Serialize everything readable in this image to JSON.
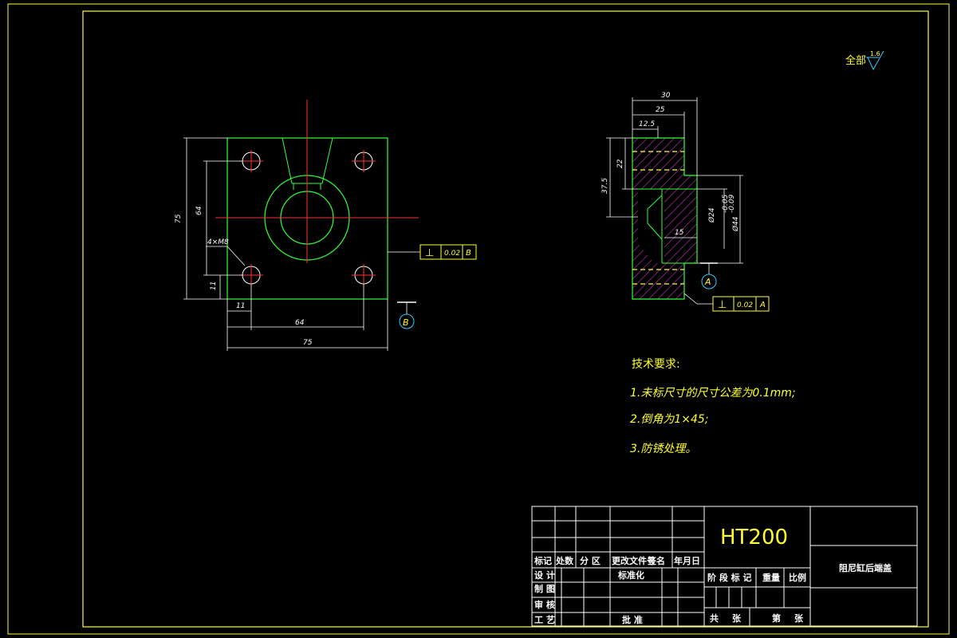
{
  "roughness_note": "全部",
  "roughness_value": "1.6",
  "front_view": {
    "dims": {
      "width_overall": "75",
      "width_holes": "64",
      "height_overall": "75",
      "height_holes": "64",
      "hole_offset_x": "11",
      "hole_offset_y": "11",
      "hole_callout": "4×M8"
    },
    "tolerance_frame": {
      "symbol": "⊥",
      "value": "0.02",
      "datum": "B"
    },
    "datum_label": "B"
  },
  "side_view": {
    "dims": {
      "width_30": "30",
      "width_25": "25",
      "width_12_5": "12.5",
      "height_22": "22",
      "height_37_5": "37.5",
      "bore_dia": "Ø24",
      "outer_dia": "Ø44",
      "outer_dia_tol_upper": "-0.05",
      "outer_dia_tol_lower": "-0.09",
      "depth_15": "15"
    },
    "tolerance_frame": {
      "symbol": "⊥",
      "value": "0.02",
      "datum": "A"
    },
    "datum_label": "A"
  },
  "tech_requirements": {
    "heading": "技术要求:",
    "items": [
      "1.未标尺寸的尺寸公差为0.1mm;",
      "2.倒角为1×45;",
      "3.防锈处理。"
    ]
  },
  "title_block": {
    "material": "HT200",
    "part_name": "阻尼缸后端盖",
    "rev_headers": [
      "标记",
      "处数",
      "分 区",
      "更改文件号",
      "签名",
      "年月日"
    ],
    "left_labels": [
      "设 计",
      "审 核",
      "工 艺"
    ],
    "left_small": "制 图",
    "standardize": "标准化",
    "approve": "批 准",
    "stage_headers": [
      "阶 段 标 记",
      "重量",
      "比例"
    ],
    "total_label": "共",
    "sheet_unit": "张",
    "sheet_label": "第",
    "sheet_unit2": "张"
  }
}
